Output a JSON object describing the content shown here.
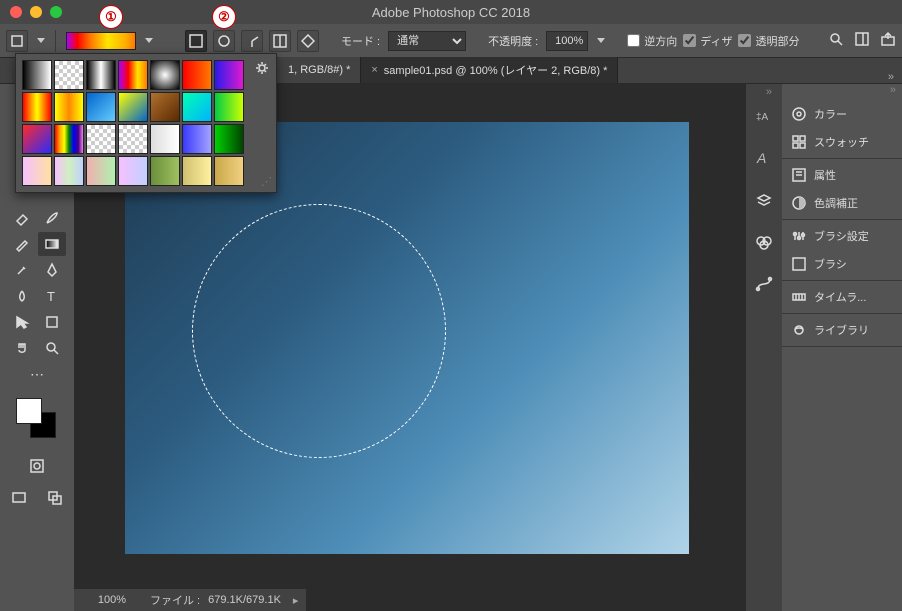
{
  "app_title": "Adobe Photoshop CC 2018",
  "annotations": {
    "a1": "①",
    "a2": "②"
  },
  "options_bar": {
    "mode_label": "モード :",
    "mode_value": "通常",
    "opacity_label": "不透明度 :",
    "opacity_value": "100%",
    "reverse_label": "逆方向",
    "dither_label": "ディザ",
    "transparency_label": "透明部分",
    "reverse_checked": false,
    "dither_checked": true,
    "transparency_checked": true
  },
  "tabs": {
    "partial": "1, RGB/8#) *",
    "active": "sample01.psd @ 100% (レイヤー 2, RGB/8) *",
    "close": "×"
  },
  "panels": {
    "color": "カラー",
    "swatches": "スウォッチ",
    "properties": "属性",
    "adjustments": "色調補正",
    "brush_settings": "ブラシ設定",
    "brushes": "ブラシ",
    "timeline": "タイムラ...",
    "libraries": "ライブラリ"
  },
  "status": {
    "zoom": "100%",
    "file_label": "ファイル :",
    "file_value": "679.1K/679.1K"
  },
  "gradient_presets": [
    "linear-gradient(90deg,#000,#fff)",
    "repeating-conic-gradient(#ccc 0 25%,#fff 0 50%) 0 0/8px 8px",
    "linear-gradient(90deg,#000,#fff,#000)",
    "linear-gradient(90deg,#a900ff,#ff0000,#ffe600,#ff7a00)",
    "radial-gradient(circle,#fff,#000)",
    "linear-gradient(90deg,#ff0000,#ff7a00)",
    "linear-gradient(90deg,#2a1aec,#e01ad0)",
    "linear-gradient(90deg,#f00,#ff0,#f00)",
    "linear-gradient(90deg,#ff0,#f80,#ff0)",
    "linear-gradient(135deg,#06c,#6cf)",
    "linear-gradient(135deg,#ff0,#06c)",
    "linear-gradient(135deg,#b07030,#5b2a00)",
    "linear-gradient(135deg,#00ffb3,#00b3ff)",
    "linear-gradient(90deg,#0c4,#cf0)",
    "linear-gradient(135deg,#ff2a2a,#2a2aff)",
    "linear-gradient(90deg,red,orange,yellow,green,blue,indigo,violet)",
    "repeating-conic-gradient(#ccc 0 25%,#fff 0 50%) 0 0/8px 8px",
    "repeating-conic-gradient(#ccc 0 25%,#fff 0 50%) 0 0/8px 8px",
    "linear-gradient(90deg,#ddd,#fff)",
    "linear-gradient(90deg,#3a3aff,#a3a3ff)",
    "linear-gradient(90deg,#00d000,#004400)",
    "linear-gradient(90deg,#f7c0ff,#ffe0a0)",
    "linear-gradient(90deg,#f7c0ff,#d0f0c0,#c0d0ff)",
    "linear-gradient(90deg,#f0b0b0,#b0f0b0)",
    "linear-gradient(90deg,#f7c0ff,#c0d0ff)",
    "linear-gradient(90deg,#6a8f3a,#a0c060)",
    "linear-gradient(90deg,#d0c070,#fff0a0)",
    "linear-gradient(90deg,#caa84a,#f0d080)"
  ]
}
